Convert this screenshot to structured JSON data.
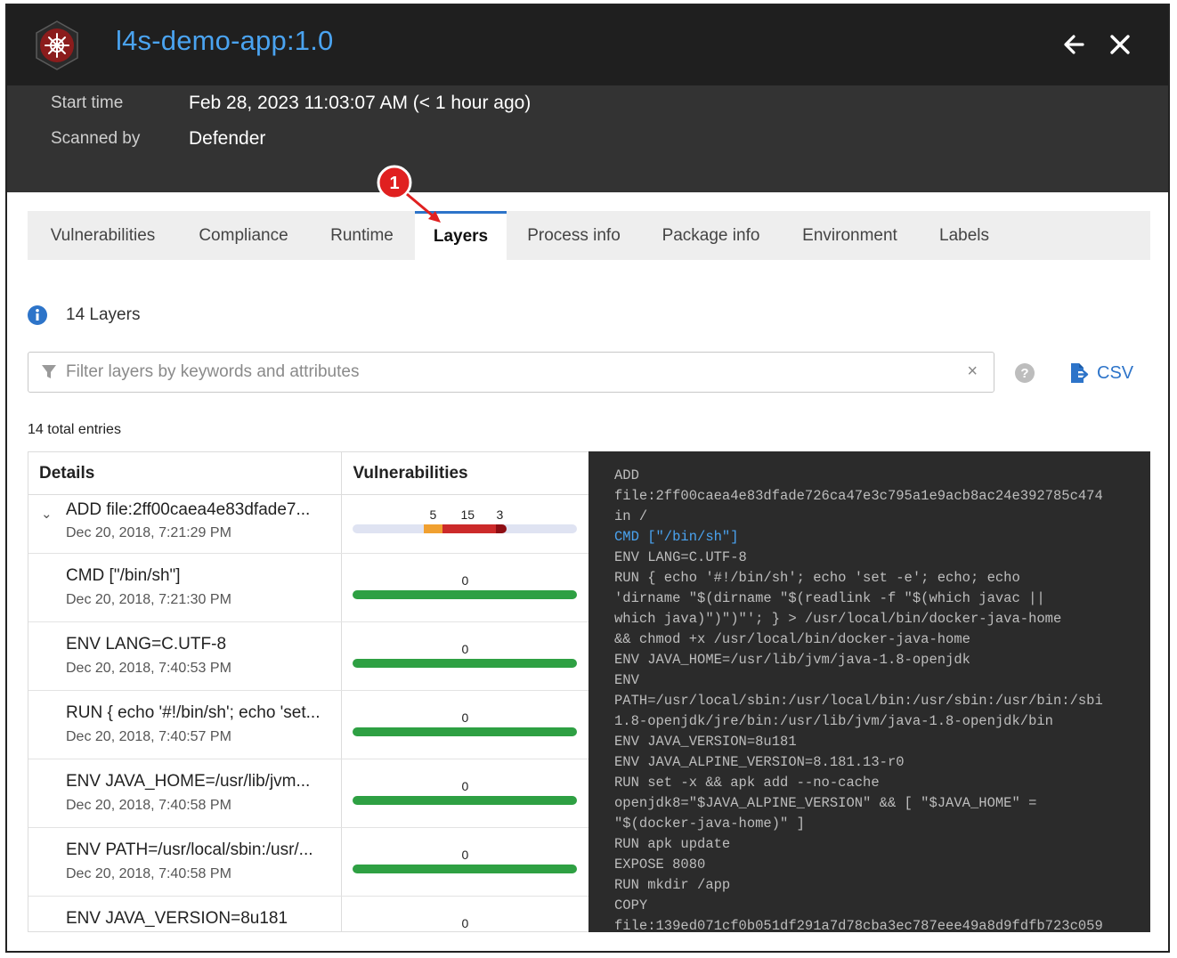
{
  "header": {
    "title": "l4s-demo-app:1.0",
    "logo_icon": "kubernetes-helm-icon",
    "back_icon": "arrow-left-icon",
    "close_icon": "close-icon"
  },
  "meta": {
    "start_time_label": "Start time",
    "start_time_value": "Feb 28, 2023 11:03:07 AM (< 1 hour ago)",
    "scanned_by_label": "Scanned by",
    "scanned_by_value": "Defender"
  },
  "tabs": [
    {
      "label": "Vulnerabilities",
      "active": false
    },
    {
      "label": "Compliance",
      "active": false
    },
    {
      "label": "Runtime",
      "active": false
    },
    {
      "label": "Layers",
      "active": true
    },
    {
      "label": "Process info",
      "active": false
    },
    {
      "label": "Package info",
      "active": false
    },
    {
      "label": "Environment",
      "active": false
    },
    {
      "label": "Labels",
      "active": false
    }
  ],
  "callout": {
    "number": "1",
    "color": "#e02020"
  },
  "layers_count": "14 Layers",
  "filter": {
    "placeholder": "Filter layers by keywords and attributes",
    "value": ""
  },
  "csv_label": "CSV",
  "total_entries": "14 total entries",
  "table": {
    "columns": [
      "Details",
      "Vulnerabilities"
    ],
    "rows": [
      {
        "title": "ADD file:2ff00caea4e83dfade7...",
        "date": "Dec 20, 2018, 7:21:29 PM",
        "expanded": true,
        "counts": [
          {
            "value": "5",
            "color": "#f0a030"
          },
          {
            "value": "15",
            "color": "#cc2a2a"
          },
          {
            "value": "3",
            "color": "#8e0e14"
          }
        ]
      },
      {
        "title": "CMD [\"/bin/sh\"]",
        "date": "Dec 20, 2018, 7:21:30 PM",
        "total": "0"
      },
      {
        "title": "ENV LANG=C.UTF-8",
        "date": "Dec 20, 2018, 7:40:53 PM",
        "total": "0"
      },
      {
        "title": "RUN { echo '#!/bin/sh'; echo 'set...",
        "date": "Dec 20, 2018, 7:40:57 PM",
        "total": "0"
      },
      {
        "title": "ENV JAVA_HOME=/usr/lib/jvm...",
        "date": "Dec 20, 2018, 7:40:58 PM",
        "total": "0"
      },
      {
        "title": "ENV PATH=/usr/local/sbin:/usr/...",
        "date": "Dec 20, 2018, 7:40:58 PM",
        "total": "0"
      },
      {
        "title": "ENV JAVA_VERSION=8u181",
        "date": "",
        "total": "0"
      }
    ]
  },
  "code_lines": [
    "ADD",
    "file:2ff00caea4e83dfade726ca47e3c795a1e9acb8ac24e392785c474",
    "in /",
    "CMD [\"/bin/sh\"]",
    "ENV LANG=C.UTF-8",
    "RUN { echo '#!/bin/sh'; echo 'set -e'; echo; echo",
    "'dirname \"$(dirname \"$(readlink -f \"$(which javac ||",
    "which java)\")\")\"'; } > /usr/local/bin/docker-java-home",
    "&& chmod +x /usr/local/bin/docker-java-home",
    "ENV JAVA_HOME=/usr/lib/jvm/java-1.8-openjdk",
    "ENV",
    "PATH=/usr/local/sbin:/usr/local/bin:/usr/sbin:/usr/bin:/sbi",
    "1.8-openjdk/jre/bin:/usr/lib/jvm/java-1.8-openjdk/bin",
    "ENV JAVA_VERSION=8u181",
    "ENV JAVA_ALPINE_VERSION=8.181.13-r0",
    "RUN set -x && apk add --no-cache",
    "openjdk8=\"$JAVA_ALPINE_VERSION\" && [ \"$JAVA_HOME\" =",
    "\"$(docker-java-home)\" ]",
    "RUN apk update",
    "EXPOSE 8080",
    "RUN mkdir /app",
    "COPY",
    "file:139ed071cf0b051df291a7d78cba3ec787eee49a8d9fdfb723c059"
  ],
  "code_highlight_index": 3,
  "colors": {
    "accent": "#2d74c9",
    "title": "#4aa3f0",
    "ok_bar": "#2ea043",
    "header_bg": "#1f1f1f",
    "meta_bg": "#333333",
    "code_bg": "#2b2b2b"
  }
}
